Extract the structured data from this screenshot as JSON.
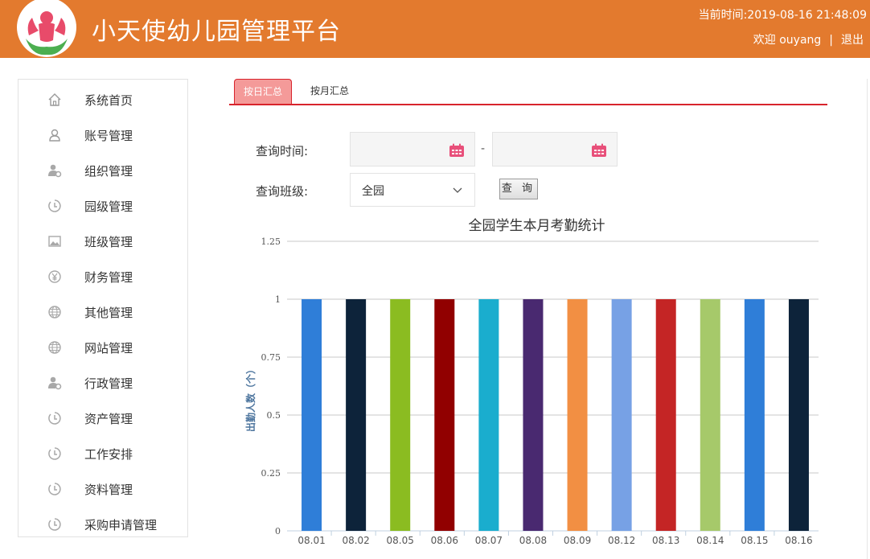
{
  "header": {
    "title": "小天使幼儿园管理平台",
    "time_label": "当前时间:",
    "time_value": "2019-08-16 21:48:09",
    "welcome": "欢迎 ouyang",
    "separator": "|",
    "logout": "退出",
    "logo_icon": "angel-logo-icon"
  },
  "sidebar": {
    "items": [
      {
        "label": "系统首页",
        "icon": "home-icon"
      },
      {
        "label": "账号管理",
        "icon": "user-icon"
      },
      {
        "label": "组织管理",
        "icon": "user-gear-icon"
      },
      {
        "label": "园级管理",
        "icon": "clock-icon"
      },
      {
        "label": "班级管理",
        "icon": "image-icon"
      },
      {
        "label": "财务管理",
        "icon": "yen-icon"
      },
      {
        "label": "其他管理",
        "icon": "globe-icon"
      },
      {
        "label": "网站管理",
        "icon": "globe-icon"
      },
      {
        "label": "行政管理",
        "icon": "user-gear-icon"
      },
      {
        "label": "资产管理",
        "icon": "clock-icon"
      },
      {
        "label": "工作安排",
        "icon": "clock-icon"
      },
      {
        "label": "资料管理",
        "icon": "clock-icon"
      },
      {
        "label": "采购申请管理",
        "icon": "clock-icon"
      }
    ]
  },
  "tabs": [
    {
      "label": "按日汇总",
      "active": true
    },
    {
      "label": "按月汇总",
      "active": false
    }
  ],
  "form": {
    "time_label": "查询时间:",
    "start_date": "",
    "end_date": "",
    "range_separator": "-",
    "class_label": "查询班级:",
    "class_selected": "全园",
    "query_button": "查 询"
  },
  "colors": {
    "header_bg": "#e37a2e",
    "accent_red": "#d8242c",
    "tab_active_bg": "#f49a99",
    "calendar_icon": "#e8507a"
  },
  "chart_data": {
    "type": "bar",
    "title": "全园学生本月考勤统计",
    "ylabel": "出勤人数（个）",
    "xlabel": "",
    "categories": [
      "08.01",
      "08.02",
      "08.05",
      "08.06",
      "08.07",
      "08.08",
      "08.09",
      "08.12",
      "08.13",
      "08.14",
      "08.15",
      "08.16"
    ],
    "values": [
      1,
      1,
      1,
      1,
      1,
      1,
      1,
      1,
      1,
      1,
      1,
      1
    ],
    "ylim": [
      0,
      1.25
    ],
    "yticks": [
      "0",
      "0.25",
      "0.5",
      "0.75",
      "1",
      "1.25"
    ],
    "bar_colors": [
      "#2f7ed8",
      "#0d233a",
      "#8bbc21",
      "#910000",
      "#1aadce",
      "#492970",
      "#f28f43",
      "#77a1e5",
      "#c42525",
      "#a6c96a",
      "#2f7ed8",
      "#0d233a"
    ],
    "grid": true,
    "legend": "none"
  }
}
